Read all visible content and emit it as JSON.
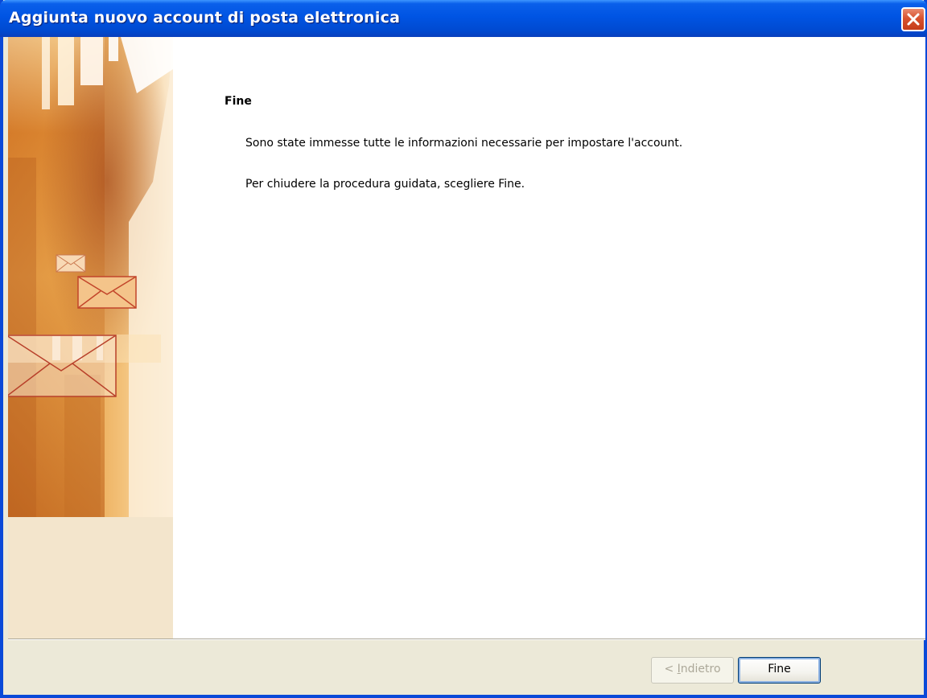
{
  "window": {
    "title": "Aggiunta nuovo account di posta elettronica"
  },
  "page": {
    "heading": "Fine",
    "line1": "Sono state immesse tutte le informazioni necessarie per impostare l'account.",
    "line2": "Per chiudere la procedura guidata, scegliere Fine."
  },
  "buttons": {
    "back_prefix": "< ",
    "back_accel": "I",
    "back_rest": "ndietro",
    "finish": "Fine"
  },
  "icons": {
    "close": "close-icon",
    "envelope": "envelope-icon"
  },
  "colors": {
    "titlebar": "#0054E3",
    "close": "#D8522F",
    "banner": "#E8A040",
    "dialog": "#ECE9D8"
  }
}
